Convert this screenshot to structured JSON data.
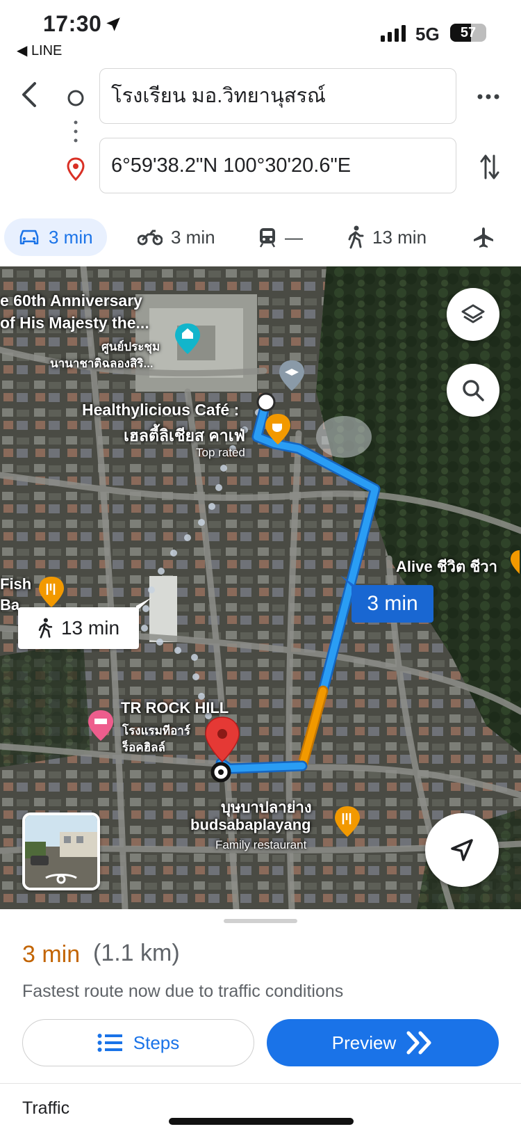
{
  "status_bar": {
    "time": "17:30",
    "back_app": "LINE",
    "network": "5G",
    "battery": "57",
    "battery_level": 0.57
  },
  "route": {
    "origin": "โรงเรียน มอ.วิทยานุสรณ์",
    "destination": "6°59'38.2\"N 100°30'20.6\"E"
  },
  "modes": [
    {
      "label": "3 min",
      "icon": "car-icon",
      "active": true
    },
    {
      "label": "3 min",
      "icon": "motorcycle-icon",
      "active": false
    },
    {
      "label": "—",
      "icon": "train-icon",
      "active": false
    },
    {
      "label": "13 min",
      "icon": "walk-icon",
      "active": false
    },
    {
      "label": "",
      "icon": "flight-icon",
      "active": false
    }
  ],
  "map": {
    "labels": {
      "anniversary_1": "e 60th Anniversary",
      "anniversary_2": "of His Majesty the...",
      "convention_1": "ศูนย์ประชุม",
      "convention_2": "นานาชาติฉลองสิริ...",
      "cafe_1": "Healthylicious Café :",
      "cafe_2": "เฮลตี้ลิเชียส คาเฟ่",
      "cafe_3": "Top rated",
      "alive": "Alive ชีวิต ชีวา",
      "fish_1": "Fish",
      "fish_2": "Ba",
      "hotel_1": "TR ROCK HILL",
      "hotel_2": "โรงแรมทีอาร์",
      "hotel_3": "ร็อคฮิลล์",
      "restaurant_1": "บุษบาปลาย่าง",
      "restaurant_2": "budsabaplayang",
      "restaurant_3": "Family restaurant"
    },
    "drive_callout": "3 min",
    "walk_callout": "13 min",
    "route_color": "#2a9df4",
    "traffic_color": "#f29900"
  },
  "summary": {
    "duration": "3 min",
    "distance": "(1.1 km)",
    "note": "Fastest route now due to traffic conditions",
    "steps_label": "Steps",
    "preview_label": "Preview",
    "traffic_label": "Traffic"
  }
}
